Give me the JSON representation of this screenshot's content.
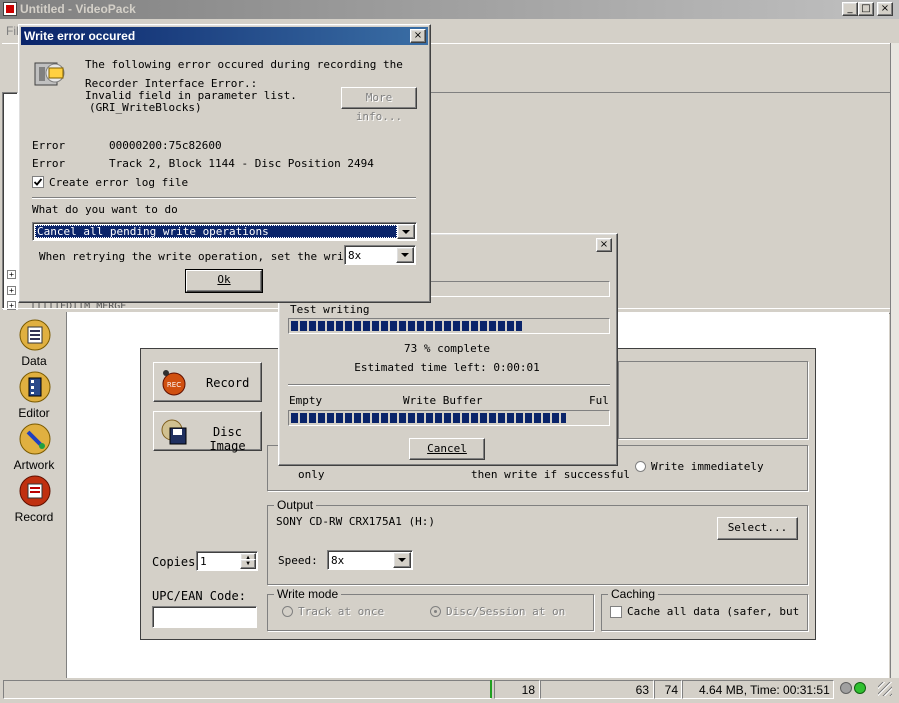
{
  "window": {
    "title": "Untitled - VideoPack",
    "menu_partial": "Fil"
  },
  "sidebar": {
    "items": [
      {
        "label": "Data",
        "icon": "data-icon"
      },
      {
        "label": "Editor",
        "icon": "editor-icon"
      },
      {
        "label": "Artwork",
        "icon": "artwork-icon"
      },
      {
        "label": "Record",
        "icon": "record-icon"
      }
    ]
  },
  "tree": {
    "partial_label": "TTTTTEDTIM MERGE"
  },
  "record_panel": {
    "record_button": "Record",
    "disc_image_button": "Disc Image",
    "mode_options": [
      {
        "label": "only",
        "selected": false
      },
      {
        "label": "then write if successful",
        "selected": false
      },
      {
        "label": "Write immediately",
        "selected": false
      }
    ],
    "output": {
      "legend": "Output",
      "device": "SONY CD-RW  CRX175A1  (H:)",
      "select_button": "Select...",
      "speed_label": "Speed:",
      "speed_value": "8x"
    },
    "copies": {
      "label": "Copies",
      "value": "1"
    },
    "upc_label": "UPC/EAN Code:",
    "upc_value": "",
    "write_mode": {
      "legend": "Write mode",
      "track_at_once": "Track at once",
      "disc_session_at_once": "Disc/Session at on"
    },
    "caching": {
      "legend": "Caching",
      "checkbox_label": "Cache all data (safer, but s",
      "checked": false
    }
  },
  "progress_dialog": {
    "top_progress": 0.3,
    "test_writing_label": "Test writing",
    "test_writing_progress": 0.73,
    "percent_text": "73 % complete",
    "estimate_text": "Estimated time left: 0:00:01",
    "buffer_empty": "Empty",
    "buffer_title": "Write Buffer",
    "buffer_full": "Ful",
    "buffer_progress": 0.87,
    "cancel_button": "Cancel"
  },
  "error_dialog": {
    "title": "Write error occured",
    "message_line1": "The following error occured during recording the",
    "message_line2": "Recorder Interface Error.:",
    "message_line3": "Invalid field in parameter list.",
    "message_line4": "(GRI_WriteBlocks)",
    "more_info_button": "More info...",
    "rows": [
      {
        "label": "Error",
        "value": "00000200:75c82600"
      },
      {
        "label": "Error",
        "value": "Track 2, Block 1144 - Disc Position 2494"
      }
    ],
    "log_checkbox_label": "Create error log file",
    "log_checked": true,
    "prompt": "What do you want to do",
    "action_value": "Cancel all pending write operations",
    "retry_label": "When retrying the write operation, set the writing",
    "retry_speed": "8x",
    "ok_button": "Ok"
  },
  "statusbar": {
    "left": "",
    "files": "18",
    "value2": "63",
    "value3": "74",
    "info": "4.64 MB, Time: 00:31:51"
  },
  "colors": {
    "title_active": "#0a246a",
    "title_inactive": "#808080",
    "selection": "#0a246a",
    "progress": "#0a246a"
  }
}
